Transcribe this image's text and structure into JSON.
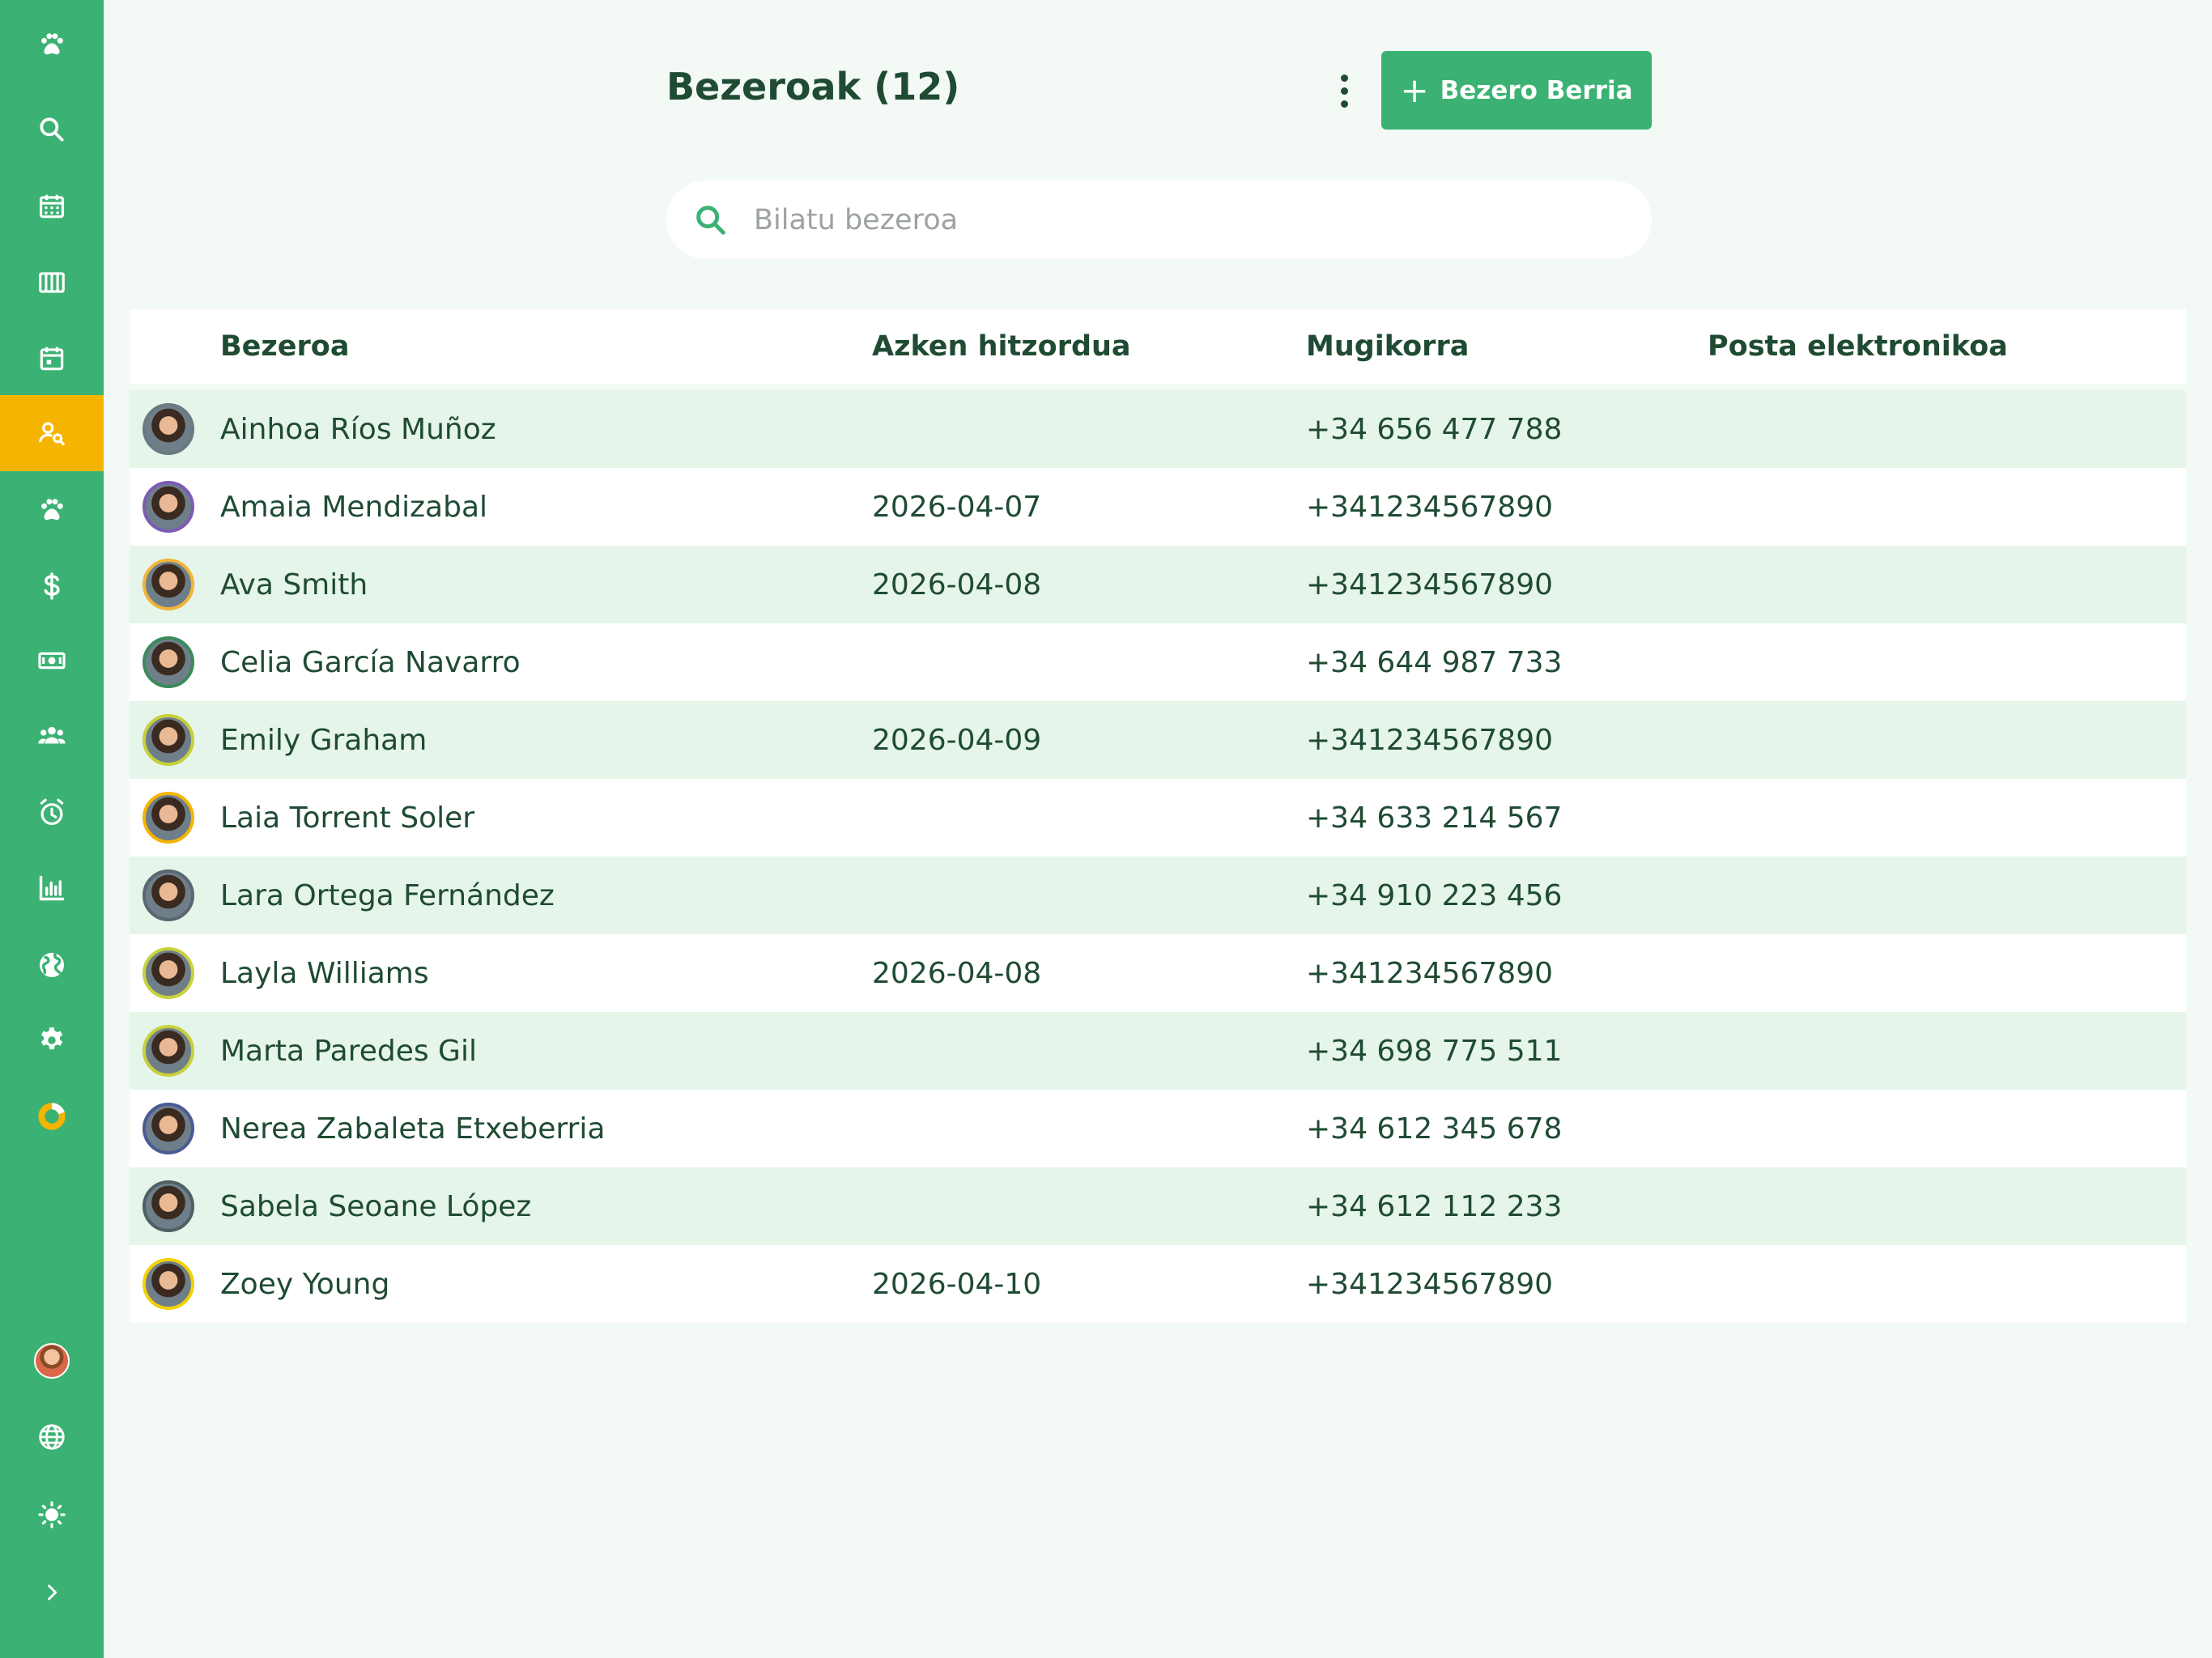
{
  "sidebar": {
    "items": [
      {
        "icon": "paw-icon",
        "active": false
      },
      {
        "icon": "search-icon",
        "active": false
      },
      {
        "icon": "calendar-grid-icon",
        "active": false
      },
      {
        "icon": "columns-icon",
        "active": false
      },
      {
        "icon": "calendar-day-icon",
        "active": false
      },
      {
        "icon": "client-search-icon",
        "active": true
      },
      {
        "icon": "paw-icon",
        "active": false
      },
      {
        "icon": "dollar-icon",
        "active": false
      },
      {
        "icon": "cash-icon",
        "active": false
      },
      {
        "icon": "team-icon",
        "active": false
      },
      {
        "icon": "alarm-icon",
        "active": false
      },
      {
        "icon": "bar-chart-icon",
        "active": false
      },
      {
        "icon": "globe-filled-icon",
        "active": false
      },
      {
        "icon": "settings-icon",
        "active": false
      },
      {
        "icon": "progress-donut-icon",
        "active": false
      }
    ],
    "bottom": [
      {
        "icon": "user-avatar"
      },
      {
        "icon": "language-globe-icon"
      },
      {
        "icon": "brightness-icon"
      },
      {
        "icon": "chevron-right-icon"
      }
    ],
    "colors": {
      "background": "#3bb273",
      "active": "#f5b400"
    }
  },
  "header": {
    "title": "Bezeroak (12)",
    "add_button_label": "Bezero Berria",
    "add_button_icon": "+"
  },
  "search": {
    "placeholder": "Bilatu bezeroa",
    "value": ""
  },
  "table": {
    "columns": [
      "Bezeroa",
      "Azken hitzordua",
      "Mugikorra",
      "Posta elektronikoa"
    ],
    "rows": [
      {
        "name": "Ainhoa Ríos Muñoz",
        "last_appointment": "",
        "mobile": "+34 656 477 788",
        "email": "",
        "ring": "#6b7a80"
      },
      {
        "name": "Amaia Mendizabal",
        "last_appointment": "2026-04-07",
        "mobile": "+341234567890",
        "email": "",
        "ring": "#7d5bb5"
      },
      {
        "name": "Ava Smith",
        "last_appointment": "2026-04-08",
        "mobile": "+341234567890",
        "email": "",
        "ring": "#f0b43a"
      },
      {
        "name": "Celia García Navarro",
        "last_appointment": "",
        "mobile": "+34 644 987 733",
        "email": "",
        "ring": "#3b8a5a"
      },
      {
        "name": "Emily Graham",
        "last_appointment": "2026-04-09",
        "mobile": "+341234567890",
        "email": "",
        "ring": "#c7cf3a"
      },
      {
        "name": "Laia Torrent Soler",
        "last_appointment": "",
        "mobile": "+34 633 214 567",
        "email": "",
        "ring": "#f5b400"
      },
      {
        "name": "Lara Ortega Fernández",
        "last_appointment": "",
        "mobile": "+34 910 223 456",
        "email": "",
        "ring": "#5a6670"
      },
      {
        "name": "Layla Williams",
        "last_appointment": "2026-04-08",
        "mobile": "+341234567890",
        "email": "",
        "ring": "#c9d13c"
      },
      {
        "name": "Marta Paredes Gil",
        "last_appointment": "",
        "mobile": "+34 698 775 511",
        "email": "",
        "ring": "#c7cf3a"
      },
      {
        "name": "Nerea Zabaleta Etxeberria",
        "last_appointment": "",
        "mobile": "+34 612 345 678",
        "email": "",
        "ring": "#4a5a96"
      },
      {
        "name": "Sabela Seoane López",
        "last_appointment": "",
        "mobile": "+34 612 112 233",
        "email": "",
        "ring": "#4f5f63"
      },
      {
        "name": "Zoey Young",
        "last_appointment": "2026-04-10",
        "mobile": "+341234567890",
        "email": "",
        "ring": "#f5d000"
      }
    ]
  },
  "colors": {
    "accent": "#3bb273",
    "text": "#1f4b33",
    "row_alt": "#e6f5e9",
    "page_bg": "#f3f9f4"
  }
}
